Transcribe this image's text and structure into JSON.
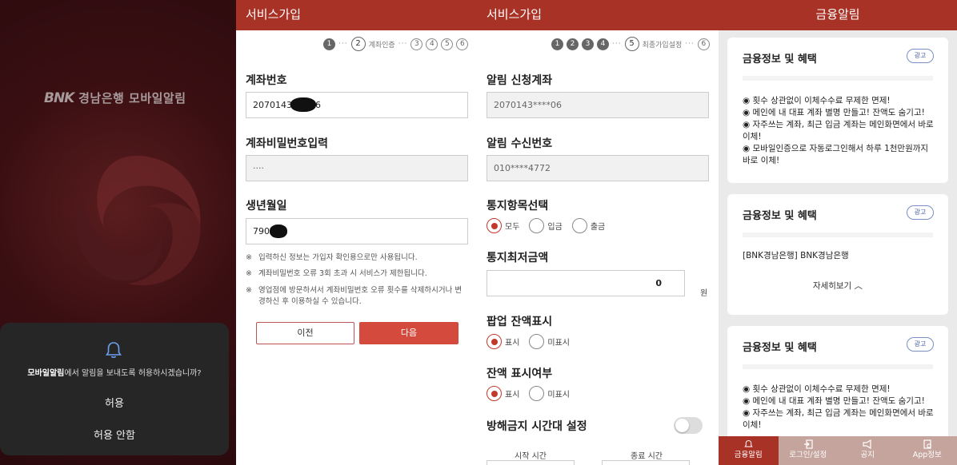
{
  "panel1": {
    "logo_brand": "BNK",
    "logo_text": "경남은행 모바일알림",
    "dialog": {
      "app_name": "모바일알림",
      "message": "에서 알림을 보내도록 허용하시겠습니까?",
      "allow": "허용",
      "deny": "허용 안함"
    }
  },
  "panel2": {
    "header": "서비스가입",
    "steps": {
      "s1": "1",
      "dots1": "···",
      "s2": "2",
      "s2_label": "계좌인증",
      "dots2": "···",
      "s3": "3",
      "s4": "4",
      "s5": "5",
      "s6": "6"
    },
    "account_label": "계좌번호",
    "account_value": "20701431",
    "account_tail": "6",
    "password_label": "계좌비밀번호입력",
    "password_value": "····",
    "birth_label": "생년월일",
    "birth_value": "7907",
    "notes": [
      "입력하신 정보는 가입자 확인용으로만 사용됩니다.",
      "계좌비밀번호 오류 3회 초과 시 서비스가 제한됩니다.",
      "영업점에 방문하셔서 계좌비밀번호 오류 횟수를 삭제하시거나 변경하신 후 이용하실 수 있습니다."
    ],
    "note_mark": "※",
    "prev": "이전",
    "next": "다음"
  },
  "panel3": {
    "header": "서비스가입",
    "steps": {
      "s1": "1",
      "s2": "2",
      "s3": "3",
      "s4": "4",
      "dots1": "···",
      "s5": "5",
      "s5_label": "최종가입설정",
      "dots2": "···",
      "s6": "6"
    },
    "alert_account_label": "알림 신청계좌",
    "alert_account_value": "2070143****06",
    "receive_number_label": "알림 수신번호",
    "receive_number_value": "010****4772",
    "notify_item_label": "통지항목선택",
    "notify_items": [
      "모두",
      "입금",
      "출금"
    ],
    "min_amount_label": "통지최저금액",
    "min_amount_value": "0",
    "min_amount_unit": "원",
    "popup_balance_label": "팝업 잔액표시",
    "popup_options": [
      "표시",
      "미표시"
    ],
    "balance_show_label": "잔액 표시여부",
    "balance_options": [
      "표시",
      "미표시"
    ],
    "dnd_label": "방해금지 시간대 설정",
    "start_time_label": "시작 시간",
    "end_time_label": "종료 시간"
  },
  "panel4": {
    "header": "금융알림",
    "cards": [
      {
        "title": "금융정보 및 혜택",
        "ad": "광고",
        "lines": [
          "◉ 횟수 상관없이 이체수수료 무제한 면제!",
          "◉ 메인에 내 대표 계좌 별명 만들고! 잔액도 숨기고!",
          "◉ 자주쓰는 계좌, 최근 입금 계좌는 메인화면에서 바로 이체!",
          "◉ 모바일인증으로 자동로그인해서 하루 1천만원까지 바로 이체!"
        ]
      },
      {
        "title": "금융정보 및 혜택",
        "ad": "광고",
        "body": "[BNK경남은행] BNK경남은행",
        "more": "자세히보기 ︿"
      },
      {
        "title": "금융정보 및 혜택",
        "ad": "광고",
        "lines": [
          "◉ 횟수 상관없이 이체수수료 무제한 면제!",
          "◉ 메인에 내 대표 계좌 별명 만들고! 잔액도 숨기고!",
          "◉ 자주쓰는 계좌, 최근 입금 계좌는 메인화면에서 바로 이체!"
        ]
      }
    ],
    "nav": [
      "금융알림",
      "로그인/설정",
      "공지",
      "App정보"
    ]
  },
  "colors": {
    "brand": "#a93226",
    "accent_red": "#c0392b",
    "nav_inactive": "#c4a49c"
  }
}
